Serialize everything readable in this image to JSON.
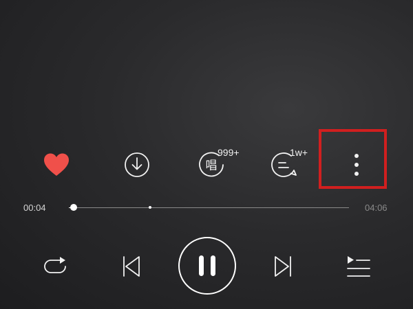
{
  "actions": {
    "like": {
      "icon": "heart-icon",
      "color": "#f0504a",
      "liked": true
    },
    "download": {
      "icon": "download-icon"
    },
    "sing": {
      "icon": "sing-icon",
      "glyph": "唱",
      "badge": "999+"
    },
    "comments": {
      "icon": "comment-icon",
      "badge": "1w+"
    },
    "more": {
      "icon": "more-vertical-icon"
    }
  },
  "highlight": {
    "color": "#d11f1f"
  },
  "progress": {
    "current_time": "00:04",
    "total_time": "04:06",
    "played_fraction": 0.016,
    "buffered_fraction": 0.29
  },
  "controls": {
    "repeat": {
      "icon": "repeat-icon"
    },
    "previous": {
      "icon": "previous-track-icon"
    },
    "play_pause": {
      "icon": "pause-icon",
      "state": "playing"
    },
    "next": {
      "icon": "next-track-icon"
    },
    "playlist": {
      "icon": "playlist-icon"
    }
  }
}
